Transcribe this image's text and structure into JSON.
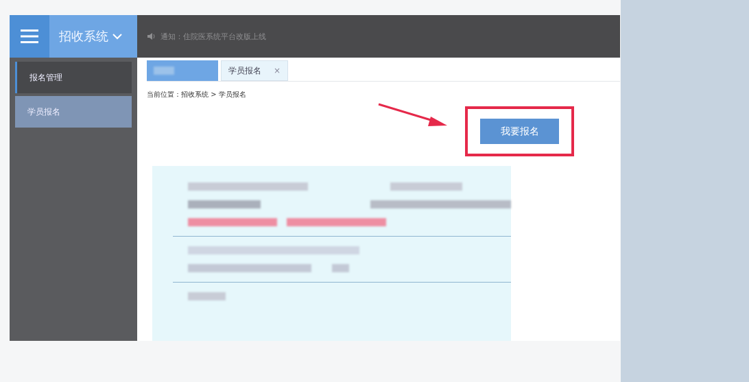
{
  "header": {
    "system_title": "招收系统",
    "notice": "通知：住院医系统平台改版上线"
  },
  "sidebar": {
    "items": [
      {
        "label": "报名管理",
        "kind": "group",
        "selected": false
      },
      {
        "label": "学员报名",
        "kind": "item",
        "selected": true
      }
    ]
  },
  "tabs": [
    {
      "label": "学员报名",
      "close": "×"
    }
  ],
  "breadcrumb": "当前位置：招收系统 > 学员报名",
  "action_button": {
    "label": "我要报名",
    "highlighted": true
  }
}
